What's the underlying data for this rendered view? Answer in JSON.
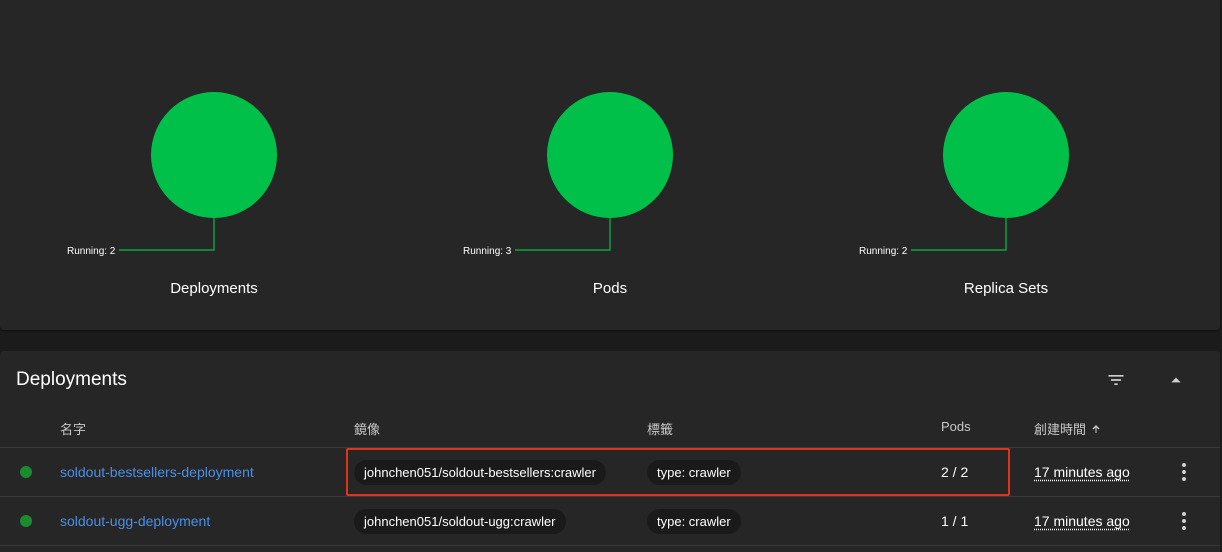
{
  "colors": {
    "running": "#00c04a",
    "link": "#4a8fe7",
    "highlight": "#e0321c",
    "status_dot": "#1a8c2e"
  },
  "workload_status": [
    {
      "title": "Deployments",
      "legend": "Running: 2"
    },
    {
      "title": "Pods",
      "legend": "Running: 3"
    },
    {
      "title": "Replica Sets",
      "legend": "Running: 2"
    }
  ],
  "deployments": {
    "title": "Deployments",
    "filter_icon": "filter-list-icon",
    "collapse_icon": "expand-less-icon",
    "columns": {
      "name": "名字",
      "images": "鏡像",
      "labels": "標籤",
      "pods": "Pods",
      "created": "創建時間",
      "created_sort_icon": "arrow-up-icon"
    },
    "rows": [
      {
        "status": "running",
        "name": "soldout-bestsellers-deployment",
        "image": "johnchen051/soldout-bestsellers:crawler",
        "label": "type: crawler",
        "pods": "2 / 2",
        "created": "17 minutes ago"
      },
      {
        "status": "running",
        "name": "soldout-ugg-deployment",
        "image": "johnchen051/soldout-ugg:crawler",
        "label": "type: crawler",
        "pods": "1 / 1",
        "created": "17 minutes ago"
      }
    ]
  }
}
